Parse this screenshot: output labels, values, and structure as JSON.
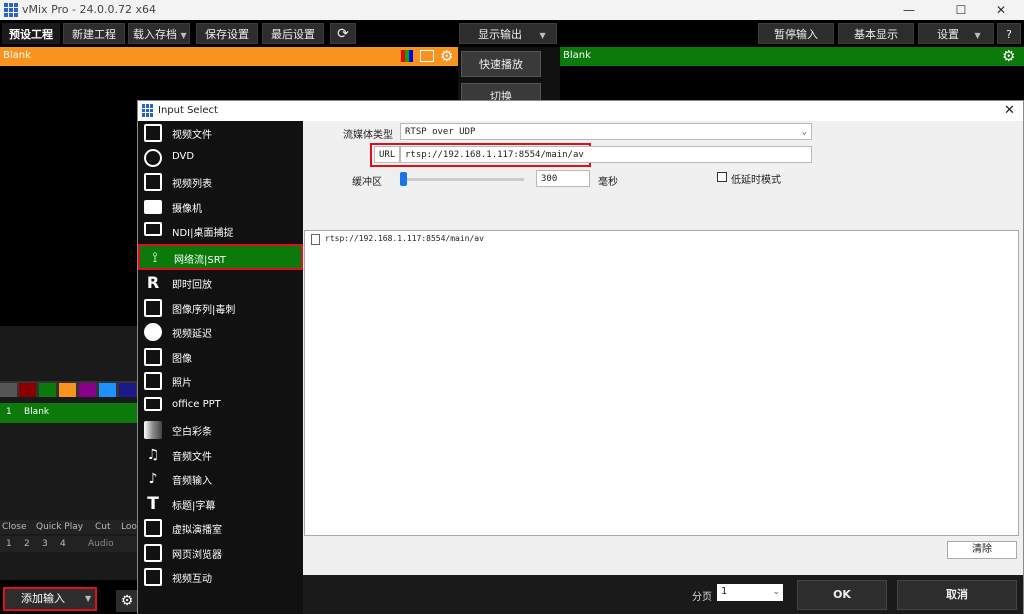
{
  "window": {
    "title": "vMix Pro - 24.0.0.72 x64",
    "minimize": "—",
    "maximize": "☐",
    "close": "✕"
  },
  "toolbar": {
    "preset": "预设工程",
    "new_project": "新建工程",
    "load_archive": "载入存档",
    "save_settings": "保存设置",
    "last_settings": "最后设置",
    "display_output": "显示输出",
    "pause_input": "暂停输入",
    "basic_display": "基本显示",
    "settings": "设置",
    "help": "?"
  },
  "preview": {
    "title": "Blank"
  },
  "output": {
    "title": "Blank"
  },
  "center": {
    "quick_play": "快速播放",
    "switch": "切换"
  },
  "input_list": {
    "index": "1",
    "name": "Blank"
  },
  "quick_play_row": {
    "labels": [
      "Close",
      "Quick Play",
      "Cut",
      "Loo"
    ],
    "numbers": [
      "1",
      "2",
      "3",
      "4"
    ],
    "audio": "Audio"
  },
  "bottom": {
    "add_input": "添加输入"
  },
  "swatch_colors": [
    "#555555",
    "#8a0000",
    "#0b7a0b",
    "#f7931e",
    "#8a008a",
    "#1e90ff",
    "#1a1a8a"
  ],
  "dialog": {
    "title": "Input Select",
    "close": "✕",
    "categories": [
      {
        "label": "视频文件",
        "icon": "video-file-icon"
      },
      {
        "label": "DVD",
        "icon": "dvd-icon"
      },
      {
        "label": "视频列表",
        "icon": "video-list-icon"
      },
      {
        "label": "摄像机",
        "icon": "camera-icon"
      },
      {
        "label": "NDI|桌面捕捉",
        "icon": "monitor-icon"
      },
      {
        "label": "网络流|SRT",
        "icon": "antenna-icon"
      },
      {
        "label": "即时回放",
        "icon": "replay-icon"
      },
      {
        "label": "图像序列|毒刺",
        "icon": "image-sequence-icon"
      },
      {
        "label": "视频延迟",
        "icon": "clock-icon"
      },
      {
        "label": "图像",
        "icon": "image-icon"
      },
      {
        "label": "照片",
        "icon": "photos-icon"
      },
      {
        "label": "office PPT",
        "icon": "presentation-icon"
      },
      {
        "label": "空白彩条",
        "icon": "color-bars-icon"
      },
      {
        "label": "音频文件",
        "icon": "audio-file-icon"
      },
      {
        "label": "音频输入",
        "icon": "microphone-icon"
      },
      {
        "label": "标题|字幕",
        "icon": "title-icon"
      },
      {
        "label": "虚拟演播室",
        "icon": "virtual-studio-icon"
      },
      {
        "label": "网页浏览器",
        "icon": "browser-icon"
      },
      {
        "label": "视频互动",
        "icon": "video-call-icon"
      }
    ],
    "stream_type_label": "流媒体类型",
    "stream_type_value": "RTSP over UDP",
    "url_label": "URL",
    "url_value": "rtsp://192.168.1.117:8554/main/av",
    "buffer_label": "缓冲区",
    "buffer_value": "300",
    "buffer_unit": "毫秒",
    "low_latency_label": "低延时模式",
    "list_items": [
      "rtsp://192.168.1.117:8554/main/av"
    ],
    "clear": "清除",
    "page_label": "分页",
    "page_value": "1",
    "ok": "OK",
    "cancel": "取消"
  }
}
